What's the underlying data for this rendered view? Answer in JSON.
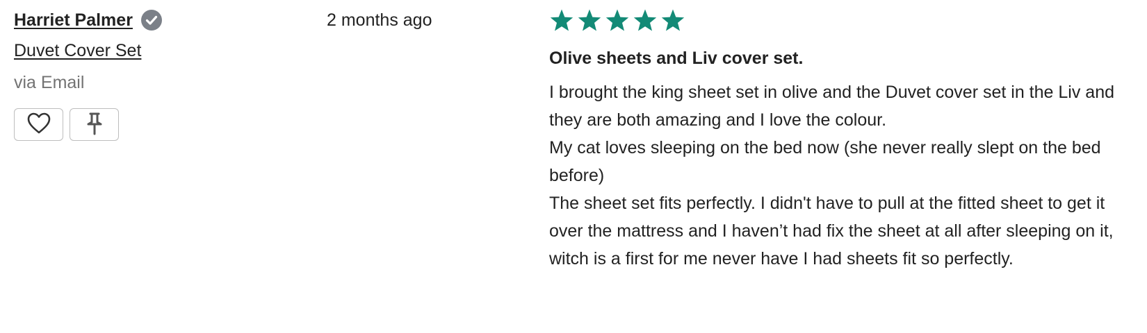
{
  "reviewer": {
    "name": "Harriet Palmer",
    "verified_icon": "verified-check-icon",
    "product": "Duvet Cover Set",
    "source": "via Email"
  },
  "actions": {
    "like_icon": "heart-icon",
    "pin_icon": "pin-icon"
  },
  "review": {
    "date": "2 months ago",
    "rating": 5,
    "rating_max": 5,
    "star_color": "#138a76",
    "title": "Olive sheets and Liv cover set.",
    "paragraphs": [
      "I brought the king sheet set in olive and the Duvet cover set in the Liv and they are both amazing and I love the colour.",
      "My cat loves sleeping on the bed now (she never really slept on the bed before)",
      "The sheet set fits perfectly. I didn't have to pull at the fitted sheet to get it over the mattress and I haven’t had fix the sheet at all after sleeping on it, witch is a first for me never have I had sheets fit so perfectly."
    ]
  },
  "colors": {
    "verified_badge": "#7b8088",
    "icon_stroke": "#333333",
    "button_border": "#bdbdbd",
    "muted_text": "#737373"
  }
}
